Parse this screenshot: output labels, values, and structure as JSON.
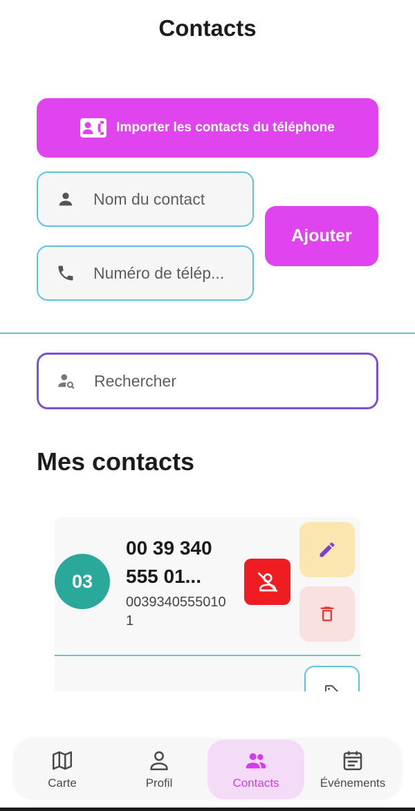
{
  "header": {
    "title": "Contacts"
  },
  "import_button": {
    "label": "Importer les contacts du téléphone",
    "icon": "contact-card-phone-icon"
  },
  "form": {
    "name_placeholder": "Nom du contact",
    "name_icon": "person-icon",
    "phone_placeholder": "Numéro de télép...",
    "phone_icon": "phone-icon",
    "add_label": "Ajouter"
  },
  "search": {
    "placeholder": "Rechercher",
    "icon": "person-search-icon"
  },
  "section": {
    "title": "Mes contacts"
  },
  "contacts": [
    {
      "initials": "03",
      "name": "00 39 340 555 01...",
      "number": "00393405550101",
      "avatar_color": "#2aa89a"
    }
  ],
  "nav": {
    "items": [
      {
        "label": "Carte",
        "icon": "map-icon"
      },
      {
        "label": "Profil",
        "icon": "profile-icon"
      },
      {
        "label": "Contacts",
        "icon": "group-icon",
        "active": true
      },
      {
        "label": "Événements",
        "icon": "calendar-icon"
      }
    ]
  },
  "colors": {
    "primary": "#df44ef",
    "field_border": "#5bc3e0",
    "search_border": "#7b4fd3",
    "block": "#ef1c22",
    "edit_bg": "#fbe6b0",
    "delete_bg": "#f8e1df",
    "nav_active_bg": "#f4dcf8",
    "nav_active_text": "#d43bea"
  }
}
